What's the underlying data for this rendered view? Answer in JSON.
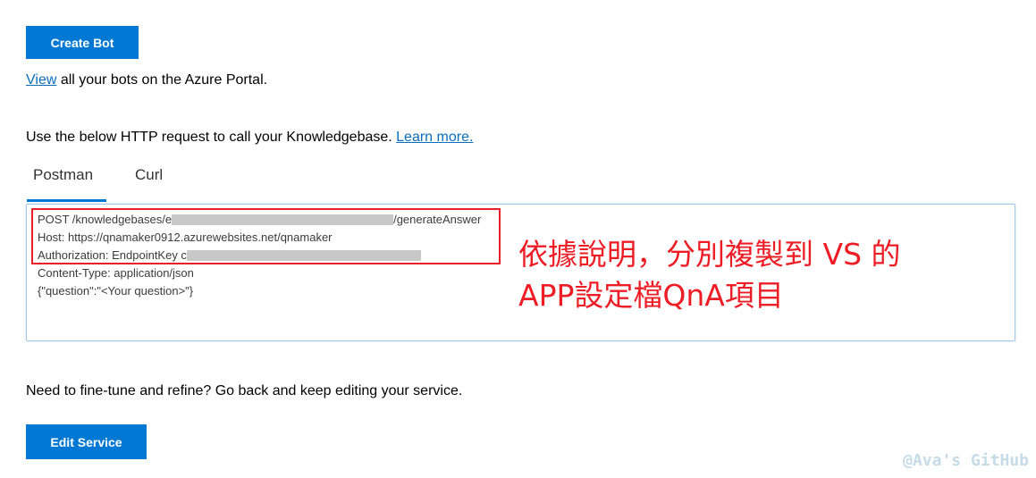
{
  "buttons": {
    "create_bot": "Create Bot",
    "edit_service": "Edit Service"
  },
  "view_line": {
    "link": "View",
    "text": " all your bots on the Azure Portal."
  },
  "http_line": {
    "text": "Use the below HTTP request to call your Knowledgebase. ",
    "link": "Learn more."
  },
  "tabs": [
    {
      "label": "Postman",
      "active": true
    },
    {
      "label": "Curl",
      "active": false
    }
  ],
  "code": {
    "line1_prefix": "POST /knowledgebases/e",
    "line1_suffix": "/generateAnswer",
    "line2": "Host: https://qnamaker0912.azurewebsites.net/qnamaker",
    "line3_prefix": "Authorization: EndpointKey c",
    "line4": "Content-Type: application/json",
    "line5": "{\"question\":\"<Your question>\"}"
  },
  "annotation": {
    "line1": "依據說明，分別複製到 VS 的",
    "line2": "APP設定檔QnA項目"
  },
  "fine_tune_line": "Need to fine-tune and refine? Go back and keep editing your service.",
  "watermark": "@Ava's GitHub",
  "colors": {
    "primary": "#0078d4",
    "link": "#0a6ebd",
    "annotation_red": "#ee1c25",
    "redaction_gray": "#c8c8c8"
  }
}
